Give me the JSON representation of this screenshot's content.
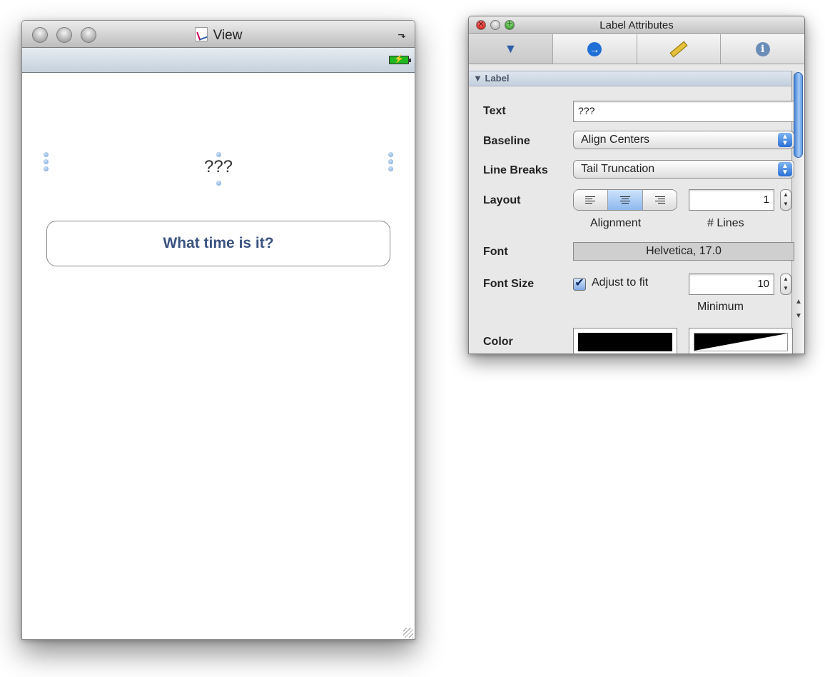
{
  "view_window": {
    "title": "View",
    "label_text": "???",
    "button_label": "What time is it?"
  },
  "inspector": {
    "title": "Label Attributes",
    "tabs": [
      {
        "icon": "attributes-slider-icon"
      },
      {
        "icon": "connections-arrow-icon"
      },
      {
        "icon": "size-ruler-icon"
      },
      {
        "icon": "identity-info-icon"
      }
    ],
    "section_title": "Label",
    "rows": {
      "text_label": "Text",
      "text_value": "???",
      "baseline_label": "Baseline",
      "baseline_value": "Align Centers",
      "line_breaks_label": "Line Breaks",
      "line_breaks_value": "Tail Truncation",
      "layout_label": "Layout",
      "lines_value": "1",
      "alignment_caption": "Alignment",
      "lines_caption": "# Lines",
      "font_label": "Font",
      "font_value": "Helvetica, 17.0",
      "font_size_label": "Font Size",
      "adjust_to_fit_label": "Adjust to fit",
      "minimum_value": "10",
      "minimum_caption": "Minimum",
      "color_label": "Color"
    }
  },
  "colors": {
    "button_text": "#3b5382",
    "accent_blue": "#2a6fd6"
  }
}
